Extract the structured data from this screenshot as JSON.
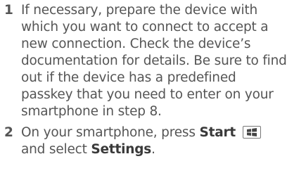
{
  "steps": [
    {
      "number": "1",
      "text": "If necessary, prepare the device with which you want to connect to accept a new connection. Check the device’s documentation for details. Be sure to find out if the device has a predefined passkey that you need to enter on your smartphone in step 8."
    },
    {
      "number": "2",
      "text_before": "On your smartphone, press ",
      "start_label": "Start",
      "start_icon": "windows-start-key-icon",
      "text_middle": "and select ",
      "settings_label": "Settings",
      "text_after": "."
    }
  ]
}
